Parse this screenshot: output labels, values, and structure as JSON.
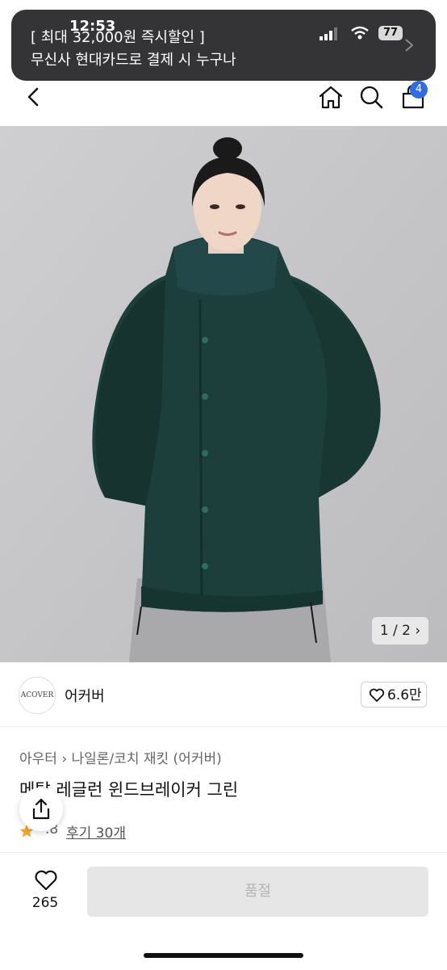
{
  "status_bar": {
    "time": "12:53",
    "battery": "77"
  },
  "notification": {
    "line1": "[ 최대 32,000원 즉시할인 ]",
    "line2": "무신사 현대카드로 결제 시 누구나"
  },
  "nav": {
    "cart_count": "4"
  },
  "gallery": {
    "counter": "1 / 2 ›"
  },
  "brand": {
    "logo_text": "ACOVER",
    "name": "어커버",
    "likes": "6.6만"
  },
  "product": {
    "breadcrumb": "아우터 › 나일론/코치 재킷 (어커버)",
    "title": "메탈 레글런 윈드브레이커 그린",
    "rating": ".8",
    "reviews": "후기 30개"
  },
  "bottom": {
    "like_count": "265",
    "buy_label": "품절"
  },
  "colors": {
    "accent": "#2f6de0",
    "jacket": "#1d3f3c",
    "star": "#f5a623"
  }
}
